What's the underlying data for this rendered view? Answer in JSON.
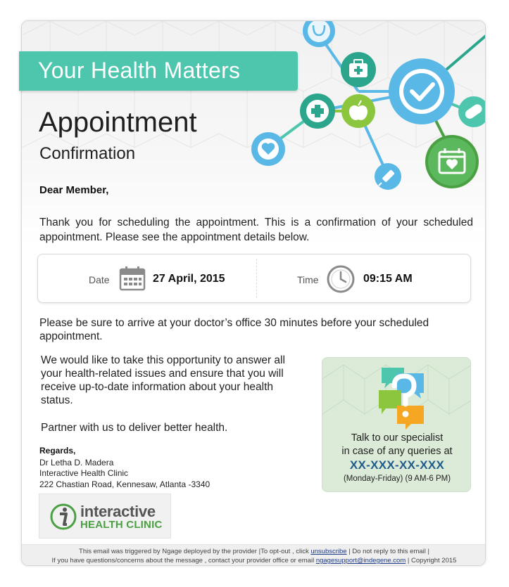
{
  "banner": {
    "title": "Your Health Matters"
  },
  "heading": {
    "title": "Appointment",
    "subtitle": "Confirmation"
  },
  "greeting": "Dear Member,",
  "intro": "Thank you for scheduling the appointment. This is a confirmation of your scheduled appointment. Please see the appointment details below.",
  "appointment": {
    "date_label": "Date",
    "date_value": "27 April, 2015",
    "time_label": "Time",
    "time_value": "09:15 AM"
  },
  "arrive_text": "Please be sure to arrive at your doctor’s office 30 minutes before your scheduled appointment.",
  "body_text": "We would like to take this opportunity to answer all your health-related issues and ensure that you will receive up-to-date information about your health status.",
  "partner_text": "Partner with us to deliver better health.",
  "signature": {
    "regards": "Regards,",
    "name": "Dr Letha D. Madera",
    "clinic": "Interactive Health Clinic",
    "address": "222 Chastian Road, Kennesaw, Atlanta -3340"
  },
  "logo": {
    "word1": "interactive",
    "word2": "HEALTH CLINIC",
    "letter": "i"
  },
  "support": {
    "line1": "Talk to our specialist",
    "line2": "in case of any queries at",
    "phone": "XX-XXX-XX-XXX",
    "hours": "(Monday-Friday) (9 AM-6 PM)"
  },
  "footer": {
    "line1_pre": "This email was triggered by Ngage deployed by the provider |To opt-out , click ",
    "unsubscribe": "unsubscribe",
    "line1_post": " | Do not reply to this email |",
    "line2_pre": "If you have questions/concerns about the message , contact your provider office or email ",
    "email": "ngagesupport@indegene.com",
    "line2_post": " | Copyright 2015"
  },
  "colors": {
    "teal": "#4ec6ad",
    "blue": "#5ab8e6",
    "green": "#4aa043",
    "phone": "#1f5c8c"
  },
  "icons": [
    "stethoscope-icon",
    "first-aid-kit-icon",
    "checkmark-icon",
    "pill-icon",
    "medical-cross-icon",
    "apple-icon",
    "heart-icon",
    "calendar-heart-icon",
    "syringe-icon",
    "calendar-icon",
    "clock-icon",
    "speech-bubbles-question-icon"
  ]
}
